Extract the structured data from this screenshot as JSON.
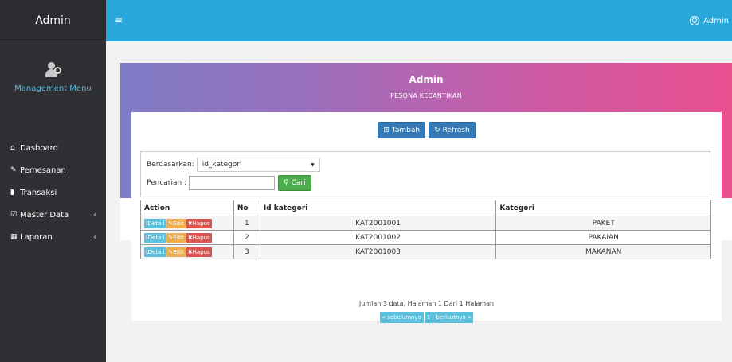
{
  "sidebar": {
    "brand": "Admin",
    "profile_label": "Management Menu",
    "items": [
      {
        "icon": "home-icon",
        "glyph": "⌂",
        "label": "Dasboard",
        "arrow": ""
      },
      {
        "icon": "pencil-icon",
        "glyph": "✎",
        "label": "Pemesanan",
        "arrow": ""
      },
      {
        "icon": "book-icon",
        "glyph": "▮",
        "label": "Transaksi",
        "arrow": ""
      },
      {
        "icon": "edit-icon",
        "glyph": "☑",
        "label": "Master Data",
        "arrow": "‹"
      },
      {
        "icon": "calendar-icon",
        "glyph": "▦",
        "label": "Laporan",
        "arrow": "‹"
      }
    ]
  },
  "topbar": {
    "menu_glyph": "≡",
    "user_name": "Admin"
  },
  "header": {
    "title": "Admin",
    "subtitle": "PESONA KECANTIKAN"
  },
  "toolbar": {
    "add_label": "Tambah",
    "refresh_label": "Refresh"
  },
  "filter": {
    "by_label": "Berdasarkan:",
    "by_value": "id_kategori",
    "search_label": "Pencarian :",
    "search_value": "",
    "search_button": "Cari"
  },
  "table": {
    "headers": [
      "Action",
      "No",
      "Id kategori",
      "Kategori"
    ],
    "action_labels": {
      "detail": "Detail",
      "edit": "Edit",
      "delete": "Hapus"
    },
    "rows": [
      {
        "no": "1",
        "id": "KAT2001001",
        "kategori": "PAKET"
      },
      {
        "no": "2",
        "id": "KAT2001002",
        "kategori": "PAKAIAN"
      },
      {
        "no": "3",
        "id": "KAT2001003",
        "kategori": "MAKANAN"
      }
    ]
  },
  "pagination": {
    "summary": "Jumlah 3 data, Halaman 1 Dari 1 Halaman",
    "prev": "« sebelumnya",
    "current": "1",
    "next": "berikutnya »"
  },
  "colors": {
    "sidebar_bg": "#2f3033",
    "topbar_bg": "#2aa8db",
    "gradient_start": "#7f7cc6",
    "gradient_end": "#e94f8f",
    "primary": "#337ab7",
    "success": "#4cae4c",
    "info": "#5bc0de",
    "warning": "#f0ad4e",
    "danger": "#d9534f"
  }
}
